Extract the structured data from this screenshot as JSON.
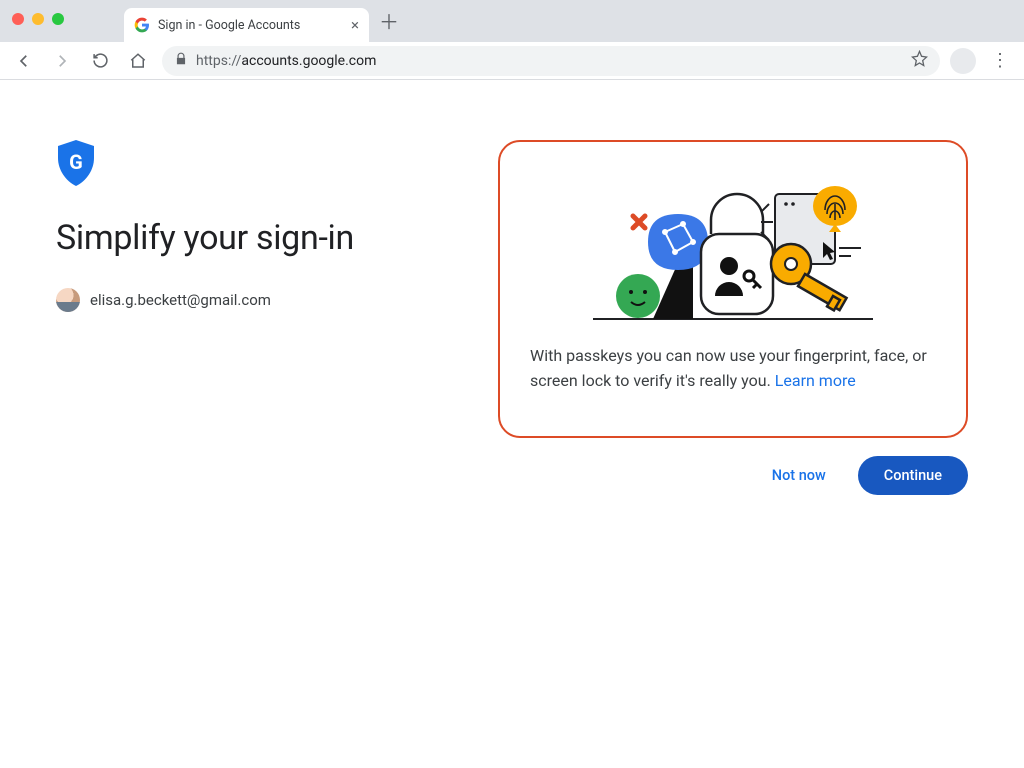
{
  "browser": {
    "tab_title": "Sign in - Google Accounts",
    "url_display_host": "https://",
    "url_display_rest": "accounts.google.com",
    "colors": {
      "close": "#ff5f57",
      "min": "#febc2e",
      "max": "#28c840"
    }
  },
  "page": {
    "headline": "Simplify your sign-in",
    "account_email": "elisa.g.beckett@gmail.com",
    "card_body": "With passkeys you can now use your fingerprint, face, or screen lock to verify it's really you. ",
    "learn_more_label": "Learn more",
    "not_now_label": "Not now",
    "continue_label": "Continue"
  },
  "colors": {
    "accent": "#dd4b26",
    "primary": "#1a73e8",
    "primary_btn": "#1858c0"
  }
}
